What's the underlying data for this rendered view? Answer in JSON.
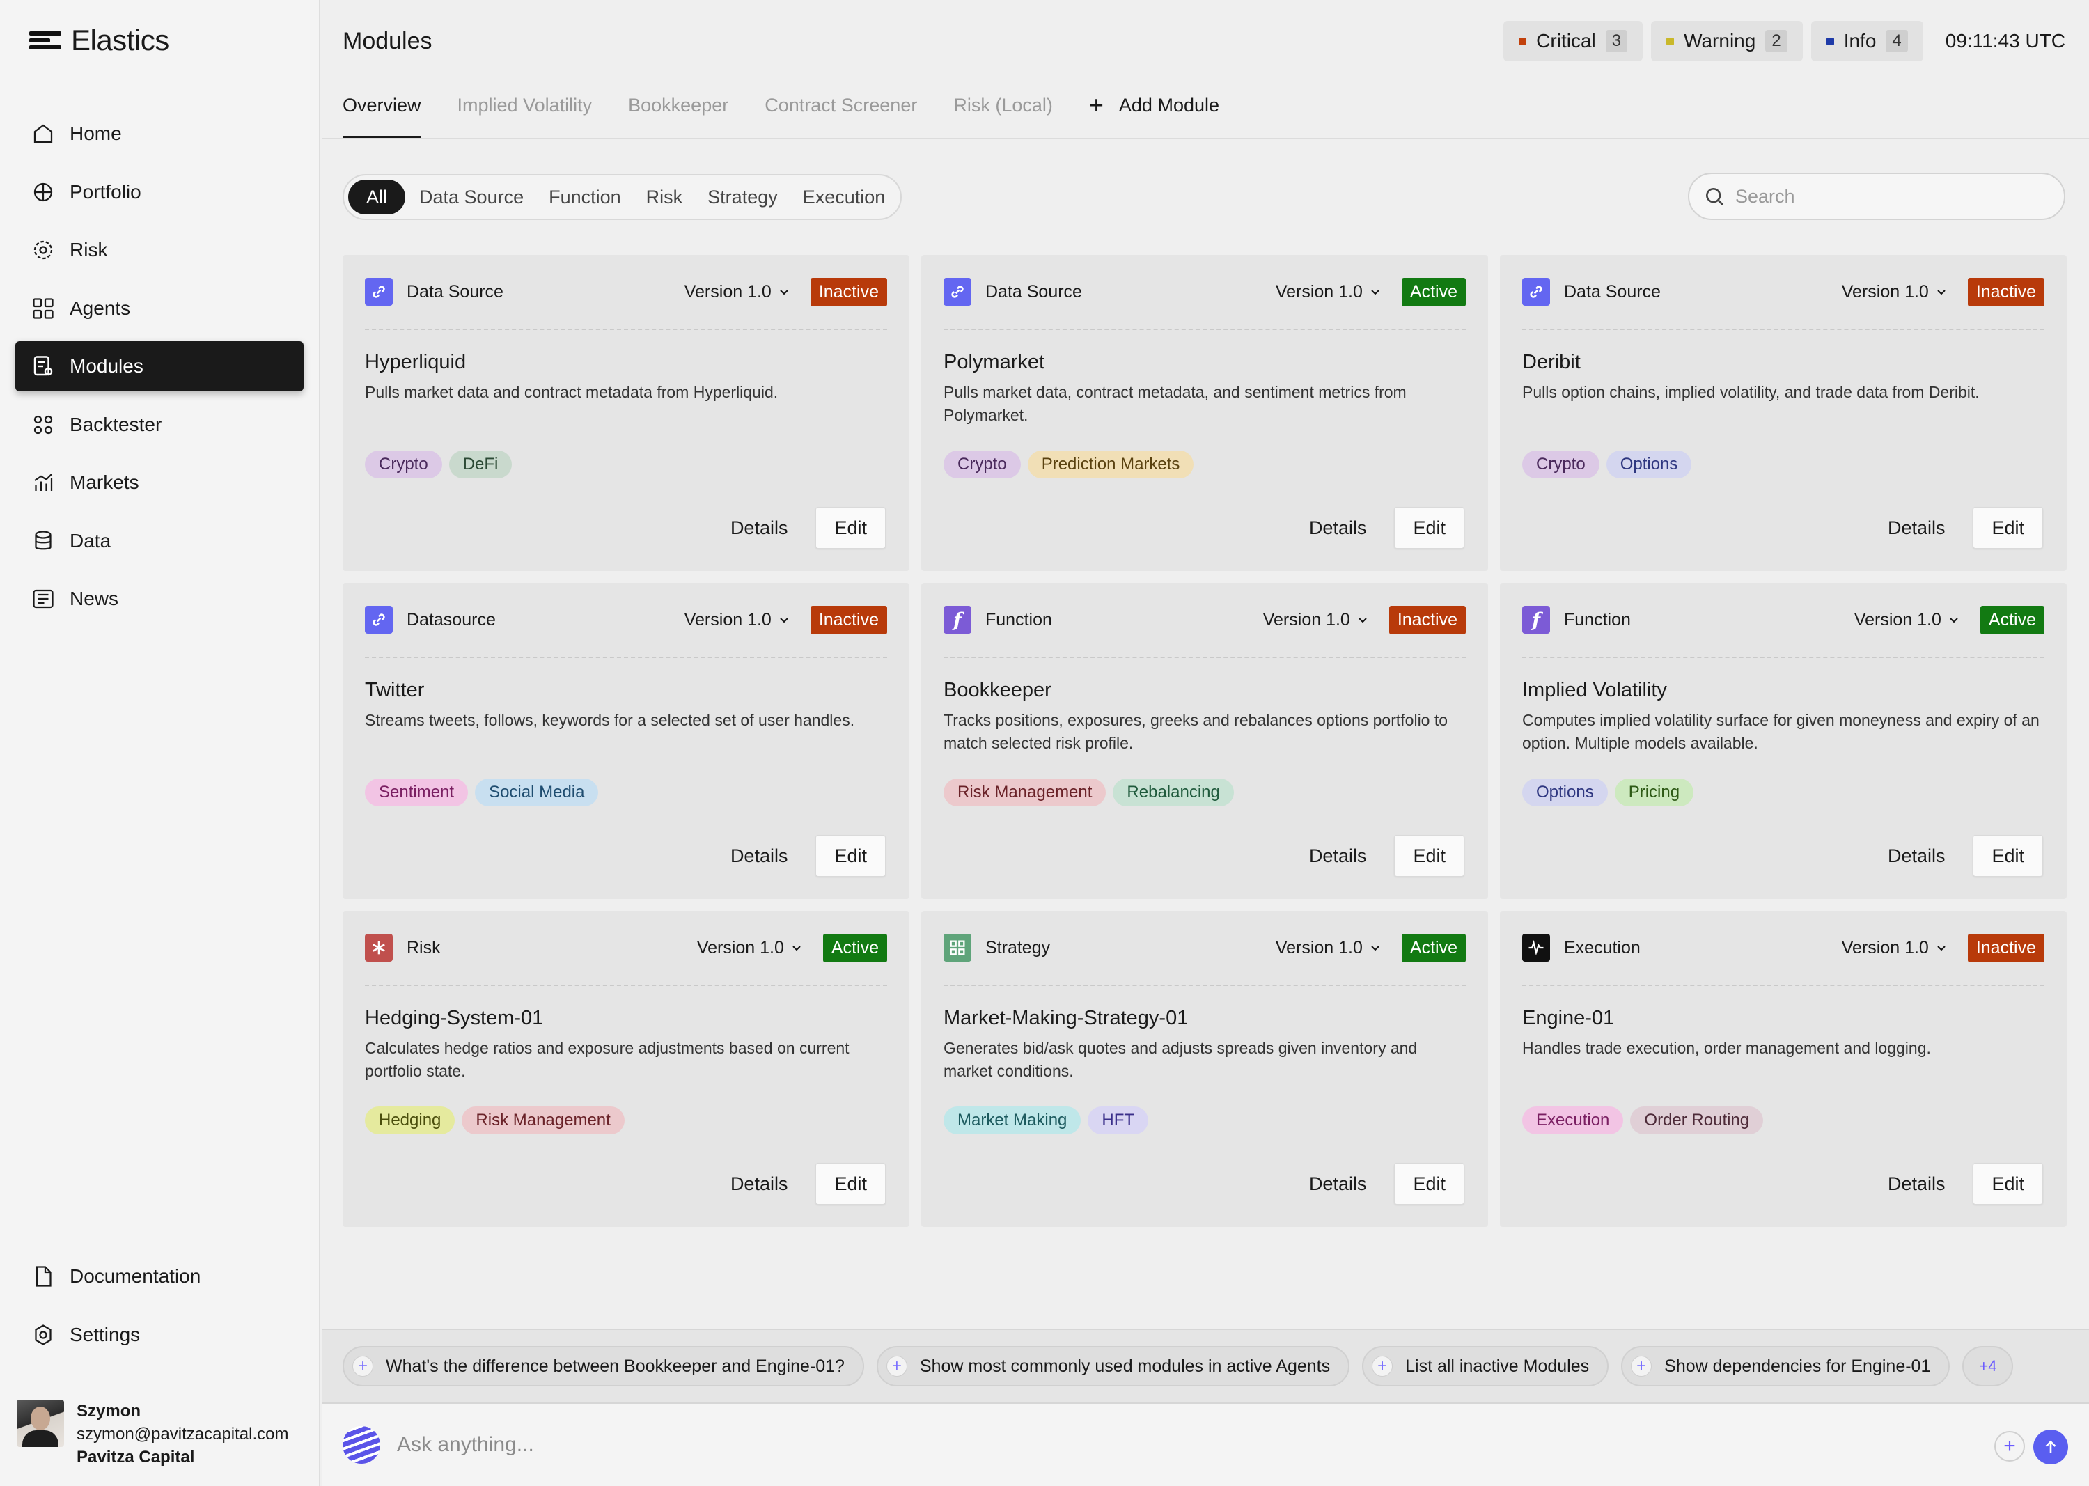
{
  "app": {
    "name": "Elastics"
  },
  "sidebar": {
    "items": [
      {
        "label": "Home",
        "icon": "home-icon"
      },
      {
        "label": "Portfolio",
        "icon": "portfolio-icon"
      },
      {
        "label": "Risk",
        "icon": "risk-icon"
      },
      {
        "label": "Agents",
        "icon": "agents-icon"
      },
      {
        "label": "Modules",
        "icon": "modules-icon",
        "active": true
      },
      {
        "label": "Backtester",
        "icon": "backtester-icon"
      },
      {
        "label": "Markets",
        "icon": "markets-icon"
      },
      {
        "label": "Data",
        "icon": "data-icon"
      },
      {
        "label": "News",
        "icon": "news-icon"
      }
    ],
    "bottom": [
      {
        "label": "Documentation",
        "icon": "documentation-icon"
      },
      {
        "label": "Settings",
        "icon": "settings-icon"
      }
    ],
    "user": {
      "name": "Szymon",
      "email": "szymon@pavitzacapital.com",
      "org": "Pavitza Capital"
    }
  },
  "header": {
    "title": "Modules",
    "alerts": [
      {
        "label": "Critical",
        "count": "3",
        "color": "#c2410c"
      },
      {
        "label": "Warning",
        "count": "2",
        "color": "#c9b82a"
      },
      {
        "label": "Info",
        "count": "4",
        "color": "#1e3aa8"
      }
    ],
    "time": "09:11:43 UTC"
  },
  "tabs": [
    "Overview",
    "Implied Volatility",
    "Bookkeeper",
    "Contract Screener",
    "Risk (Local)"
  ],
  "add_module_label": "Add Module",
  "filters": [
    "All",
    "Data Source",
    "Function",
    "Risk",
    "Strategy",
    "Execution"
  ],
  "search": {
    "placeholder": "Search"
  },
  "modules": [
    {
      "type": "Data Source",
      "icon": "link-icon",
      "icon_color": "#6366f1",
      "version": "Version 1.0",
      "status": "Inactive",
      "title": "Hyperliquid",
      "desc": "Pulls market data and contract metadata from Hyperliquid.",
      "tags": [
        {
          "label": "Crypto",
          "bg": "#dcc9e6",
          "fg": "#4a2a5c"
        },
        {
          "label": "DeFi",
          "bg": "#c9d9cd",
          "fg": "#2c4a35"
        }
      ]
    },
    {
      "type": "Data Source",
      "icon": "link-icon",
      "icon_color": "#6366f1",
      "version": "Version 1.0",
      "status": "Active",
      "title": "Polymarket",
      "desc": "Pulls market data, contract metadata, and sentiment metrics from Polymarket.",
      "tags": [
        {
          "label": "Crypto",
          "bg": "#dcc9e6",
          "fg": "#4a2a5c"
        },
        {
          "label": "Prediction Markets",
          "bg": "#f1dfb6",
          "fg": "#5a4210"
        }
      ]
    },
    {
      "type": "Data Source",
      "icon": "link-icon",
      "icon_color": "#6366f1",
      "version": "Version 1.0",
      "status": "Inactive",
      "title": "Deribit",
      "desc": "Pulls option chains, implied volatility, and trade data from Deribit.",
      "tags": [
        {
          "label": "Crypto",
          "bg": "#dcc9e6",
          "fg": "#4a2a5c"
        },
        {
          "label": "Options",
          "bg": "#d4d6ef",
          "fg": "#2f3780"
        }
      ]
    },
    {
      "type": "Datasource",
      "icon": "link-icon",
      "icon_color": "#6366f1",
      "version": "Version 1.0",
      "status": "Inactive",
      "title": "Twitter",
      "desc": "Streams tweets, follows, keywords for a selected set of user handles.",
      "tags": [
        {
          "label": "Sentiment",
          "bg": "#f2c4e4",
          "fg": "#7a1f62"
        },
        {
          "label": "Social Media",
          "bg": "#c8dff0",
          "fg": "#1f4d70"
        }
      ]
    },
    {
      "type": "Function",
      "icon": "function-icon",
      "icon_color": "#7c5bd6",
      "version": "Version 1.0",
      "status": "Inactive",
      "title": "Bookkeeper",
      "desc": "Tracks positions, exposures, greeks and rebalances options portfolio to match selected risk profile.",
      "tags": [
        {
          "label": "Risk Management",
          "bg": "#ecc9cc",
          "fg": "#6a2228"
        },
        {
          "label": "Rebalancing",
          "bg": "#c8e2d4",
          "fg": "#1f5a3c"
        }
      ]
    },
    {
      "type": "Function",
      "icon": "function-icon",
      "icon_color": "#7c5bd6",
      "version": "Version 1.0",
      "status": "Active",
      "title": "Implied Volatility",
      "desc": "Computes implied volatility surface for given moneyness and expiry of an option. Multiple models available.",
      "tags": [
        {
          "label": "Options",
          "bg": "#d4d6ef",
          "fg": "#2f3780"
        },
        {
          "label": "Pricing",
          "bg": "#cde9bf",
          "fg": "#2e5a16"
        }
      ]
    },
    {
      "type": "Risk",
      "icon": "asterisk-icon",
      "icon_color": "#c0504d",
      "version": "Version 1.0",
      "status": "Active",
      "title": "Hedging-System-01",
      "desc": "Calculates hedge ratios and exposure adjustments based on current portfolio state.",
      "tags": [
        {
          "label": "Hedging",
          "bg": "#e5ea9e",
          "fg": "#4a4d0c"
        },
        {
          "label": "Risk Management",
          "bg": "#ecc9cc",
          "fg": "#6a2228"
        }
      ]
    },
    {
      "type": "Strategy",
      "icon": "strategy-icon",
      "icon_color": "#5fa47a",
      "version": "Version 1.0",
      "status": "Active",
      "title": "Market-Making-Strategy-01",
      "desc": "Generates bid/ask quotes and adjusts spreads given inventory and market conditions.",
      "tags": [
        {
          "label": "Market Making",
          "bg": "#bfe7e9",
          "fg": "#1c5a5e"
        },
        {
          "label": "HFT",
          "bg": "#d9d6f3",
          "fg": "#3a2f8a"
        }
      ]
    },
    {
      "type": "Execution",
      "icon": "execution-icon",
      "icon_color": "#111111",
      "version": "Version 1.0",
      "status": "Inactive",
      "title": "Engine-01",
      "desc": "Handles trade execution, order management and logging.",
      "tags": [
        {
          "label": "Execution",
          "bg": "#f2c4e4",
          "fg": "#7a1f62"
        },
        {
          "label": "Order Routing",
          "bg": "#e0cfd6",
          "fg": "#4d2a38"
        }
      ]
    }
  ],
  "actions": {
    "details": "Details",
    "edit": "Edit"
  },
  "suggestions": [
    "What's the difference between Bookkeeper and Engine-01?",
    "Show most commonly used modules in active Agents",
    "List all inactive Modules",
    "Show dependencies for Engine-01"
  ],
  "suggestions_more": "+4",
  "ask": {
    "placeholder": "Ask anything..."
  }
}
